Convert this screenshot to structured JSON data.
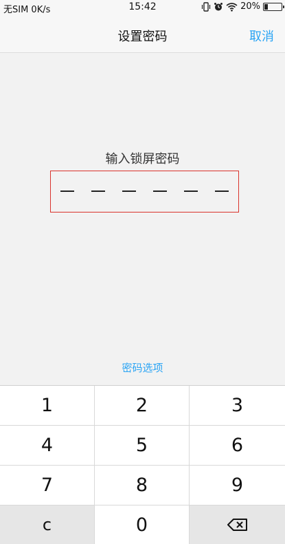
{
  "status_bar": {
    "carrier": "无SIM 0K/s",
    "time": "15:42",
    "battery_percent": "20%",
    "battery_level": 0.2,
    "icons": [
      "vibrate-icon",
      "alarm-icon",
      "wifi-icon",
      "battery-icon"
    ]
  },
  "nav": {
    "title": "设置密码",
    "cancel": "取消"
  },
  "prompt": "输入锁屏密码",
  "pin": {
    "length": 6,
    "entered": 0
  },
  "options_link": "密码选项",
  "keypad": {
    "keys": [
      "1",
      "2",
      "3",
      "4",
      "5",
      "6",
      "7",
      "8",
      "9",
      "c",
      "0"
    ],
    "backspace_icon": "backspace-icon"
  },
  "colors": {
    "accent": "#2aa4f4",
    "highlight_border": "#d9322b",
    "background": "#f2f2f2"
  }
}
